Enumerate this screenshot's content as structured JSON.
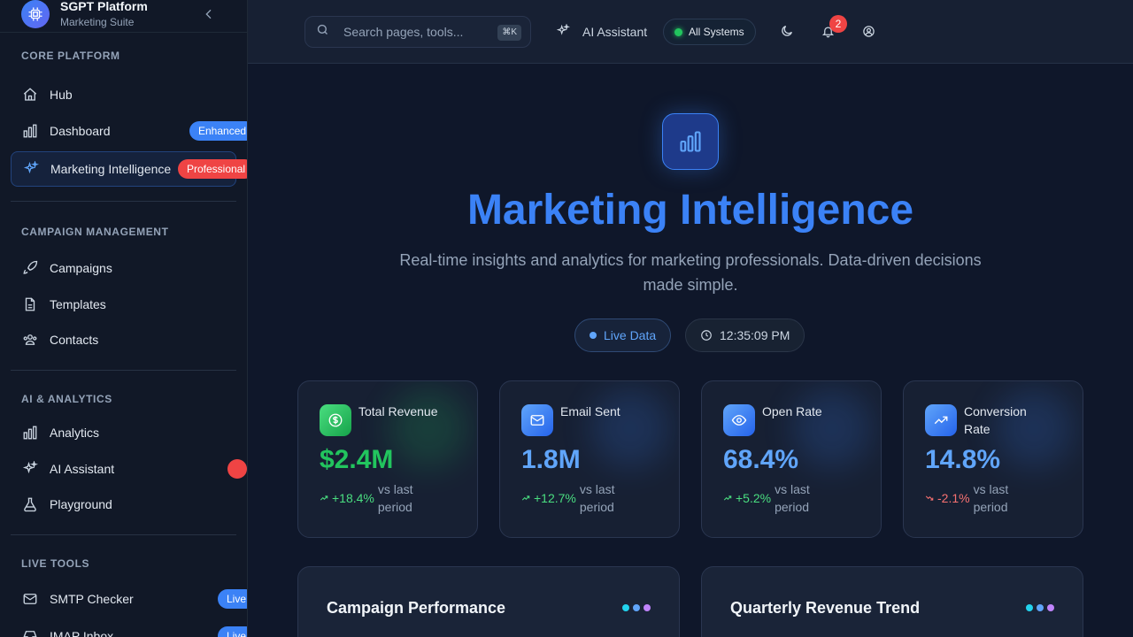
{
  "brand": {
    "title": "SGPT Platform",
    "subtitle": "Marketing Suite"
  },
  "sidebar": {
    "sections": [
      {
        "title": "CORE PLATFORM"
      },
      {
        "title": "CAMPAIGN MANAGEMENT"
      },
      {
        "title": "AI & ANALYTICS"
      },
      {
        "title": "LIVE TOOLS"
      }
    ],
    "items": {
      "hub": {
        "label": "Hub"
      },
      "dashboard": {
        "label": "Dashboard",
        "badge": "Enhanced"
      },
      "marketing": {
        "label": "Marketing Intelligence",
        "badge": "Professional"
      },
      "campaigns": {
        "label": "Campaigns"
      },
      "templates": {
        "label": "Templates"
      },
      "contacts": {
        "label": "Contacts"
      },
      "analytics": {
        "label": "Analytics"
      },
      "ai_assistant": {
        "label": "AI Assistant"
      },
      "playground": {
        "label": "Playground"
      },
      "smtp": {
        "label": "SMTP Checker",
        "badge": "Live"
      },
      "imap": {
        "label": "IMAP Inbox",
        "badge": "Live"
      }
    }
  },
  "topbar": {
    "search_placeholder": "Search pages, tools...",
    "search_shortcut": "⌘K",
    "ai_assistant_label": "AI Assistant",
    "status_label": "All Systems",
    "notification_count": "2"
  },
  "hero": {
    "title": "Marketing Intelligence",
    "subtitle": "Real-time insights and analytics for marketing professionals. Data-driven decisions made simple.",
    "live_label": "Live Data",
    "time": "12:35:09 PM"
  },
  "stats": [
    {
      "label": "Total Revenue",
      "value": "$2.4M",
      "change": "+18.4%",
      "vs": "vs last period",
      "color": "#22c55e"
    },
    {
      "label": "Email Sent",
      "value": "1.8M",
      "change": "+12.7%",
      "vs": "vs last period",
      "color": "#60a5fa"
    },
    {
      "label": "Open Rate",
      "value": "68.4%",
      "change": "+5.2%",
      "vs": "vs last period",
      "color": "#60a5fa"
    },
    {
      "label": "Conversion Rate",
      "value": "14.8%",
      "change": "-2.1%",
      "vs": "vs last period",
      "color": "#60a5fa"
    }
  ],
  "panels": [
    {
      "title": "Campaign Performance"
    },
    {
      "title": "Quarterly Revenue Trend"
    }
  ],
  "colors": {
    "accent": "#3b82f6",
    "positive": "#22c55e",
    "negative": "#ef4444"
  }
}
